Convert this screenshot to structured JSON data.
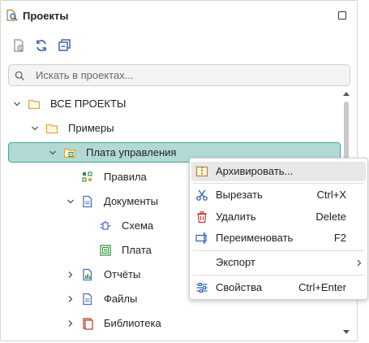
{
  "panel": {
    "title": "Проекты"
  },
  "search": {
    "placeholder": "Искать в проектах..."
  },
  "tree": {
    "root": "ВСЕ ПРОЕКТЫ",
    "examples": "Примеры",
    "board_mgmt": "Плата управления",
    "rules": "Правила",
    "documents": "Документы",
    "schema": "Схема",
    "board": "Плата",
    "reports": "Отчёты",
    "files": "Файлы",
    "library": "Библиотека"
  },
  "context_menu": {
    "archive": "Архивировать...",
    "cut": "Вырезать",
    "cut_shortcut": "Ctrl+X",
    "delete": "Удалить",
    "delete_shortcut": "Delete",
    "rename": "Переименовать",
    "rename_shortcut": "F2",
    "export": "Экспорт",
    "properties": "Свойства",
    "properties_shortcut": "Ctrl+Enter"
  },
  "colors": {
    "selection_bg": "#b2dad4",
    "selection_border": "#4aa597",
    "folder": "#e8a33d",
    "delete_red": "#c0392b",
    "doc_blue": "#4a6fc9"
  }
}
